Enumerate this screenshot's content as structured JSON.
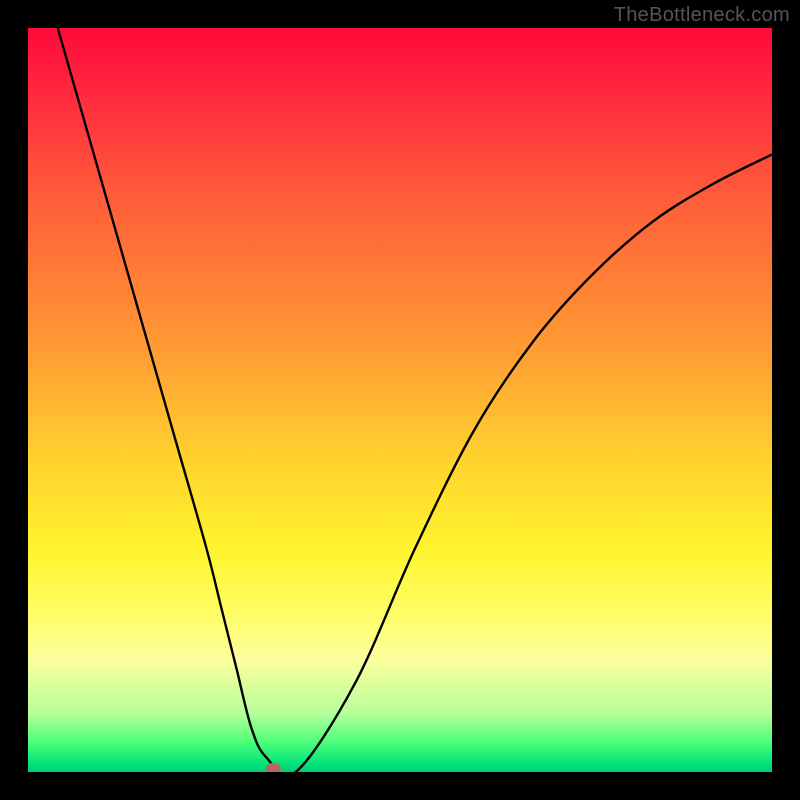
{
  "watermark": "TheBottleneck.com",
  "chart_data": {
    "type": "line",
    "title": "",
    "xlabel": "",
    "ylabel": "",
    "xlim": [
      0,
      100
    ],
    "ylim": [
      0,
      100
    ],
    "legend": false,
    "grid": false,
    "background": "red-yellow-green vertical gradient",
    "series": [
      {
        "name": "bottleneck-curve",
        "x": [
          4,
          8,
          12,
          16,
          20,
          24,
          26,
          28,
          30,
          32,
          36,
          44,
          52,
          60,
          68,
          76,
          84,
          92,
          100
        ],
        "y": [
          100,
          86,
          72,
          58,
          44,
          30,
          22,
          14,
          6,
          2,
          0,
          12,
          30,
          46,
          58,
          67,
          74,
          79,
          83
        ]
      }
    ],
    "annotations": [
      {
        "name": "minimum-point",
        "x": 33,
        "y": 0.5,
        "shape": "oval",
        "color": "#b36a5e"
      }
    ]
  }
}
